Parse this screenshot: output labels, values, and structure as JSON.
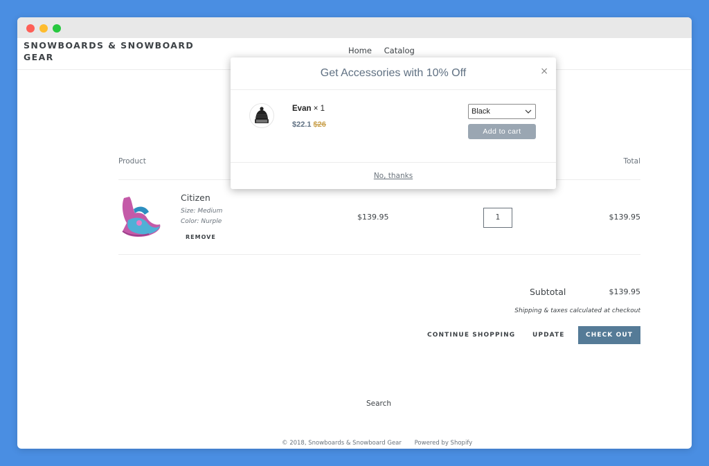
{
  "site": {
    "name": "SNOWBOARDS & SNOWBOARD GEAR",
    "nav": [
      "Home",
      "Catalog"
    ]
  },
  "cart": {
    "columns": {
      "product": "Product",
      "total": "Total"
    },
    "items": [
      {
        "title": "Citizen",
        "size": "Size: Medium",
        "color": "Color: Nurple",
        "remove_label": "REMOVE",
        "price": "$139.95",
        "quantity": "1",
        "total": "$139.95"
      }
    ],
    "subtotal_label": "Subtotal",
    "subtotal_value": "$139.95",
    "shipping_note": "Shipping & taxes calculated at checkout",
    "buttons": {
      "continue": "CONTINUE SHOPPING",
      "update": "UPDATE",
      "checkout": "CHECK OUT"
    }
  },
  "footer": {
    "search": "Search",
    "copyright": "© 2018, Snowboards & Snowboard Gear",
    "powered": "Powered by Shopify"
  },
  "modal": {
    "title": "Get Accessories with 10% Off",
    "close": "×",
    "offer": {
      "name": "Evan",
      "qty": "× 1",
      "price_new": "$22.1",
      "price_old": "$26",
      "variant": "Black",
      "add_label": "Add to cart"
    },
    "decline": "No, thanks"
  },
  "colors": {
    "background": "#4a8ee2",
    "accent": "#557b97",
    "sale_price": "#c9a04c"
  }
}
